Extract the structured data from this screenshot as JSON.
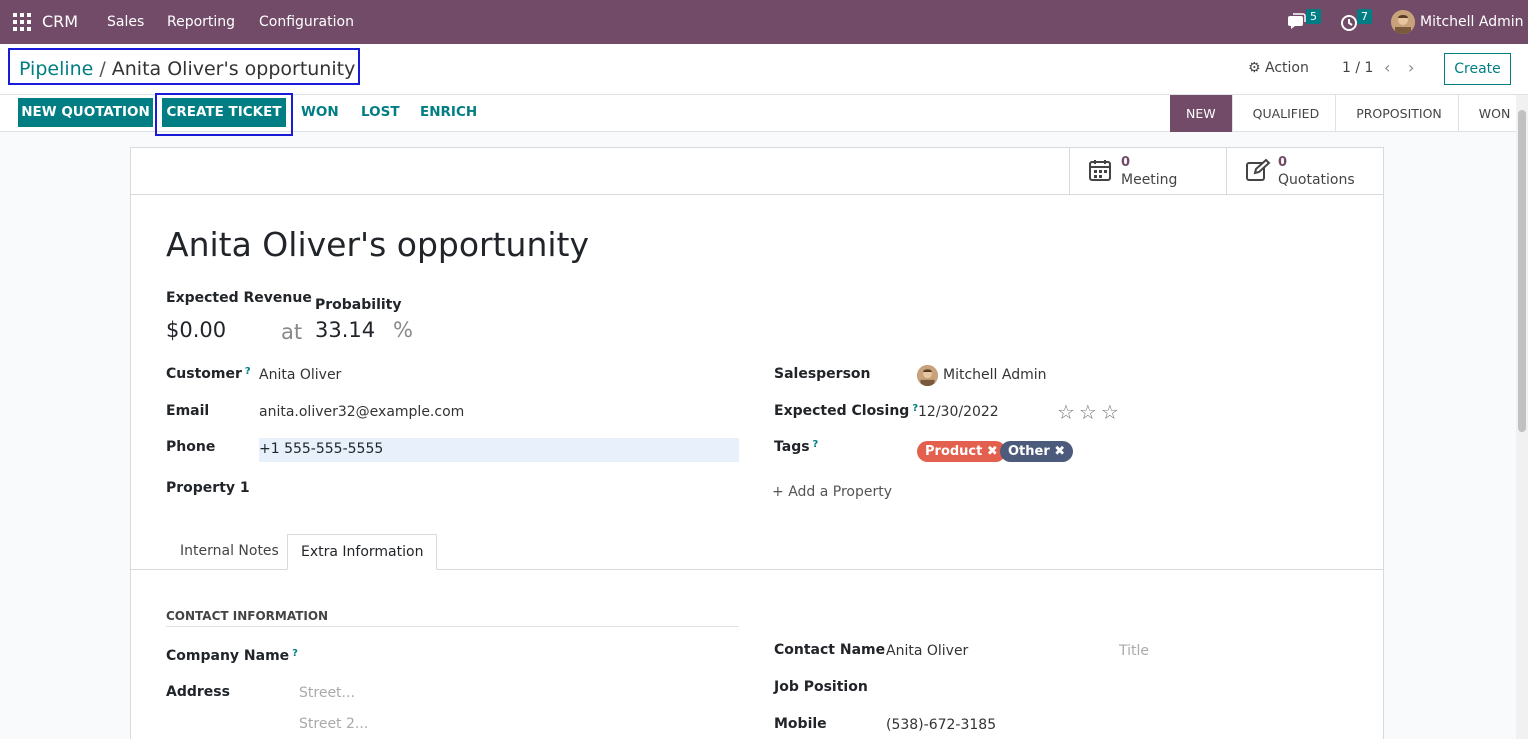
{
  "navbar": {
    "brand": "CRM",
    "menu": [
      "Sales",
      "Reporting",
      "Configuration"
    ],
    "messages_count": "5",
    "activities_count": "7",
    "user_name": "Mitchell Admin"
  },
  "control_panel": {
    "breadcrumb_parent": "Pipeline",
    "breadcrumb_sep": "/",
    "breadcrumb_current": "Anita Oliver's opportunity",
    "action_label": "Action",
    "pager": "1 / 1",
    "create_label": "Create"
  },
  "buttons": {
    "new_quotation": "NEW QUOTATION",
    "create_ticket": "CREATE TICKET",
    "won": "WON",
    "lost": "LOST",
    "enrich": "ENRICH"
  },
  "stages": [
    {
      "label": "NEW",
      "active": true
    },
    {
      "label": "QUALIFIED",
      "active": false
    },
    {
      "label": "PROPOSITION",
      "active": false
    },
    {
      "label": "WON",
      "active": false
    }
  ],
  "smart_buttons": {
    "meeting_count": "0",
    "meeting_label": "Meeting",
    "quotations_count": "0",
    "quotations_label": "Quotations"
  },
  "record": {
    "title": "Anita Oliver's opportunity",
    "expected_revenue_label": "Expected Revenue",
    "expected_revenue": "$0.00",
    "at_label": "at",
    "probability_label": "Probability",
    "probability": "33.14",
    "percent_sign": "%",
    "customer_label": "Customer",
    "customer": "Anita Oliver",
    "email_label": "Email",
    "email": "anita.oliver32@example.com",
    "phone_label": "Phone",
    "phone": "+1 555-555-5555",
    "property_label": "Property 1",
    "salesperson_label": "Salesperson",
    "salesperson": "Mitchell Admin",
    "expected_closing_label": "Expected Closing",
    "expected_closing": "12/30/2022",
    "priority_stars": "☆☆☆",
    "tags_label": "Tags",
    "tags": [
      {
        "label": "Product",
        "color": "#e4604e"
      },
      {
        "label": "Other",
        "color": "#4c5a7b"
      }
    ],
    "add_property": "Add a Property",
    "help_mark": "?"
  },
  "tabs": [
    "Internal Notes",
    "Extra Information"
  ],
  "extra_info": {
    "section_title": "CONTACT INFORMATION",
    "company_name_label": "Company Name",
    "address_label": "Address",
    "street_placeholder": "Street...",
    "street2_placeholder": "Street 2...",
    "contact_name_label": "Contact Name",
    "contact_name": "Anita Oliver",
    "title_placeholder": "Title",
    "job_position_label": "Job Position",
    "mobile_label": "Mobile",
    "mobile": "(538)-672-3185"
  },
  "colors": {
    "brand": "#714b67",
    "accent": "#017e84",
    "highlight_frame": "#1a1ad9"
  }
}
